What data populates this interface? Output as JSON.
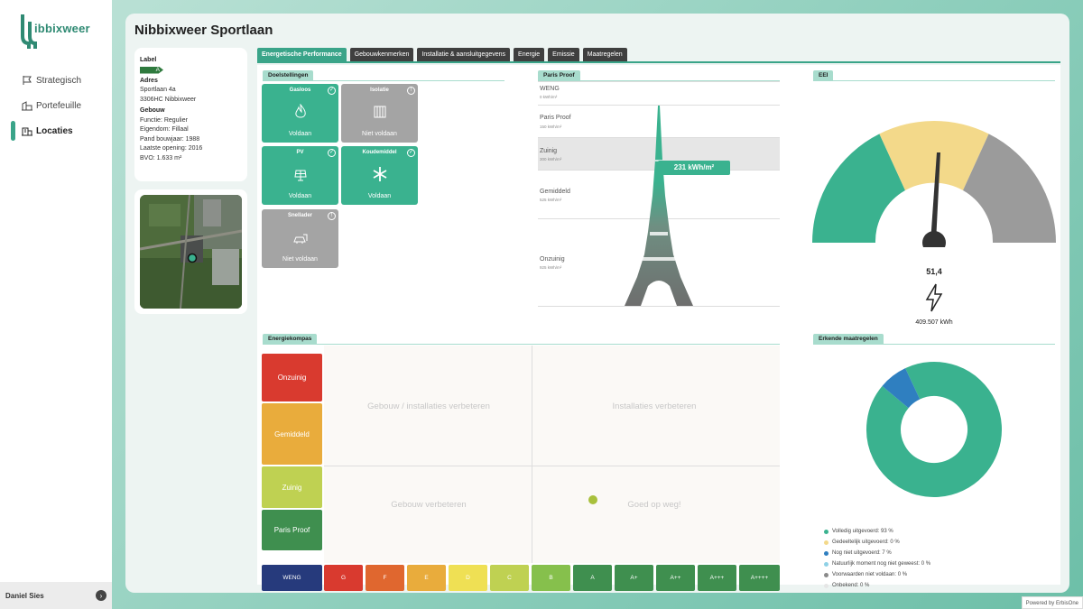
{
  "brand": {
    "name": "ibbixweer",
    "color": "#2f8a73"
  },
  "nav": {
    "items": [
      {
        "label": "Strategisch",
        "icon": "flag-icon"
      },
      {
        "label": "Portefeuille",
        "icon": "buildings-icon"
      },
      {
        "label": "Locaties",
        "icon": "building-location-icon",
        "active": true
      }
    ]
  },
  "user": {
    "name": "Daniel Sies"
  },
  "page": {
    "title": "Nibbixweer Sportlaan"
  },
  "info": {
    "label_title": "Label",
    "label_value": "A",
    "adres_title": "Adres",
    "adres_line1": "Sportlaan 4a",
    "adres_line2": "3306HC Nibbixweer",
    "gebouw_title": "Gebouw",
    "functie": "Functie: Regulier",
    "eigendom": "Eigendom: Fillaal",
    "bouwjaar": "Pand bouwjaar: 1988",
    "opening": "Laatste opening: 2016",
    "bvo": "BVO: 1.633 m²"
  },
  "tabs": [
    {
      "label": "Energetische Performance",
      "active": true
    },
    {
      "label": "Gebouwkenmerken"
    },
    {
      "label": "Installatie & aansluitgegevens"
    },
    {
      "label": "Energie"
    },
    {
      "label": "Emissie"
    },
    {
      "label": "Maatregelen"
    }
  ],
  "sections": {
    "doelstellingen": "Doelstellingen",
    "paris_proof": "Paris Proof",
    "eei": "EEI",
    "energiekompas": "Energiekompas",
    "erkende": "Erkende maatregelen"
  },
  "goals": [
    {
      "title": "Gasloos",
      "status": "Voldaan",
      "ok": true,
      "icon": "flame-icon"
    },
    {
      "title": "Isolatie",
      "status": "Niet voldaan",
      "ok": false,
      "icon": "insulation-icon"
    },
    {
      "title": "PV",
      "status": "Voldaan",
      "ok": true,
      "icon": "solar-panel-icon"
    },
    {
      "title": "Koudemiddel",
      "status": "Voldaan",
      "ok": true,
      "icon": "snowflake-icon"
    },
    {
      "title": "Snellader",
      "status": "Niet voldaan",
      "ok": false,
      "icon": "charger-icon"
    }
  ],
  "paris": {
    "rows": [
      {
        "name": "WENG",
        "value": "0 kWh/m²"
      },
      {
        "name": "Paris Proof",
        "value": "150 kWh/m²"
      },
      {
        "name": "Zuinig",
        "value": "300 kWh/m²"
      },
      {
        "name": "Gemiddeld",
        "value": "525 kWh/m²"
      },
      {
        "name": "Onzuinig",
        "value": "925 kWh/m²"
      }
    ],
    "current": "231 kWh/m²"
  },
  "eei": {
    "value": "51,4",
    "kwh": "409.507 kWh",
    "colors": {
      "good": "#3ab28f",
      "mid": "#f3d98a",
      "bad": "#9b9b9b"
    }
  },
  "kompas": {
    "left": [
      {
        "label": "Onzuinig",
        "color": "#d93a2f"
      },
      {
        "label": "Gemiddeld",
        "color": "#e9ac3c"
      },
      {
        "label": "Zuinig",
        "color": "#bfd152"
      },
      {
        "label": "Paris Proof",
        "color": "#3f8f4f"
      }
    ],
    "quads": {
      "tl": "Gebouw / installaties verbeteren",
      "tr": "Installaties verbeteren",
      "bl": "Gebouw verbeteren",
      "br": "Goed op weg!"
    },
    "bottom": [
      {
        "label": "WENG",
        "color": "#263a7c"
      },
      {
        "label": "G",
        "color": "#d93a2f"
      },
      {
        "label": "F",
        "color": "#e0672f"
      },
      {
        "label": "E",
        "color": "#e9ac3c"
      },
      {
        "label": "D",
        "color": "#efe054"
      },
      {
        "label": "C",
        "color": "#bfd152"
      },
      {
        "label": "B",
        "color": "#86c04c"
      },
      {
        "label": "A",
        "color": "#3f8f4f"
      },
      {
        "label": "A+",
        "color": "#3f8f4f"
      },
      {
        "label": "A++",
        "color": "#3f8f4f"
      },
      {
        "label": "A+++",
        "color": "#3f8f4f"
      },
      {
        "label": "A++++",
        "color": "#3f8f4f"
      }
    ]
  },
  "erkende": {
    "legend": [
      {
        "label": "Volledig uitgevoerd: 93 %",
        "color": "#3ab28f"
      },
      {
        "label": "Gedeeltelijk uitgevoerd: 0 %",
        "color": "#f3d98a"
      },
      {
        "label": "Nog niet uitgevoerd: 7 %",
        "color": "#2f7fc0"
      },
      {
        "label": "Natuurlijk moment nog niet geweest: 0 %",
        "color": "#8fd1e6"
      },
      {
        "label": "Voorwaarden niet voldaan: 0 %",
        "color": "#8a8a8a"
      },
      {
        "label": "Onbekend: 0 %",
        "color": "#e6e6e6"
      }
    ],
    "chart_data": {
      "type": "pie",
      "categories": [
        "Volledig uitgevoerd",
        "Gedeeltelijk uitgevoerd",
        "Nog niet uitgevoerd",
        "Natuurlijk moment nog niet geweest",
        "Voorwaarden niet voldaan",
        "Onbekend"
      ],
      "values": [
        93,
        0,
        7,
        0,
        0,
        0
      ]
    }
  },
  "footer": {
    "powered": "Powered by ErbisOne"
  }
}
